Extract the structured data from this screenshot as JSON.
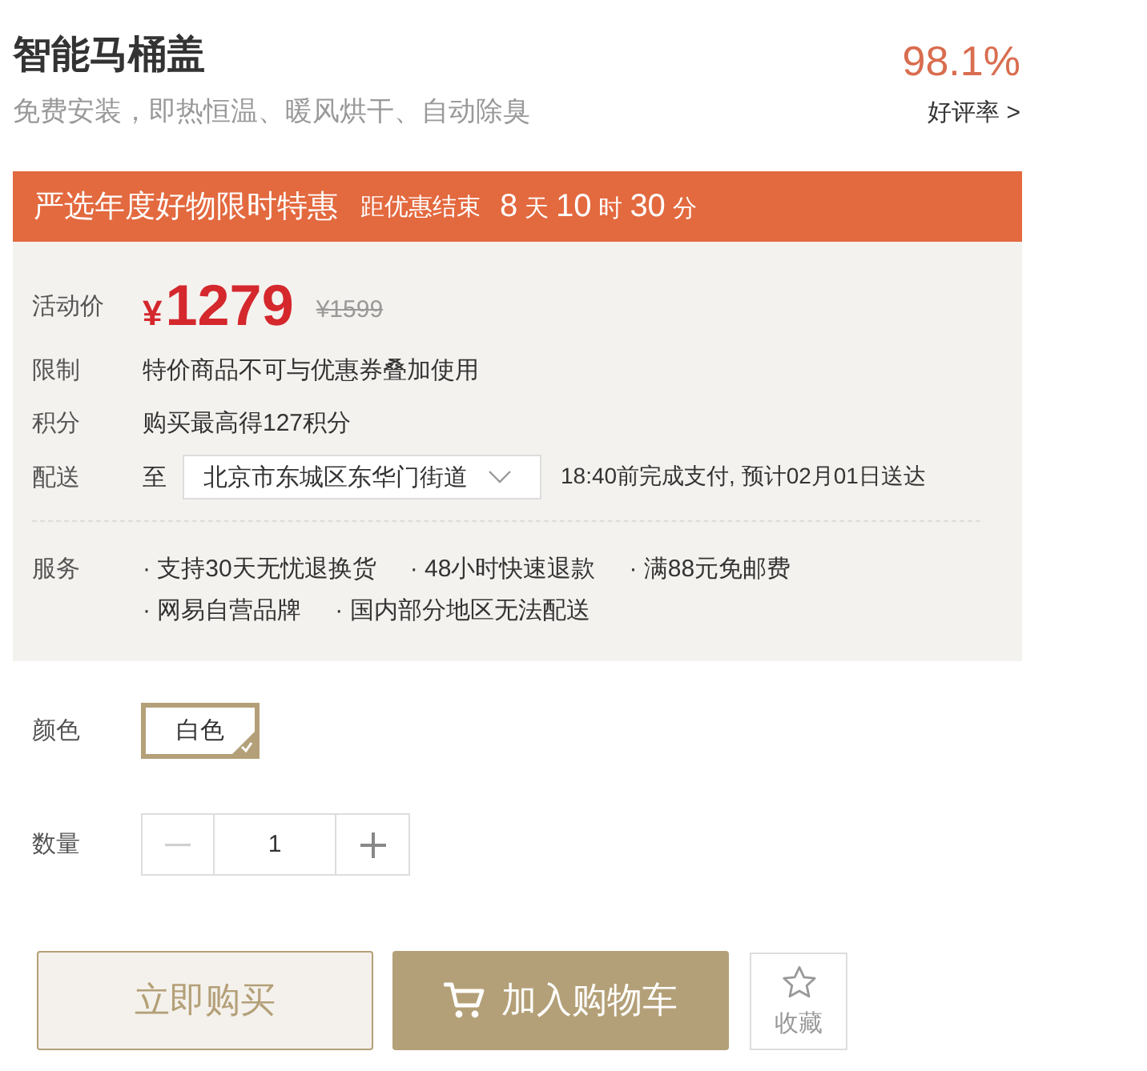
{
  "product": {
    "title": "智能马桶盖",
    "subtitle": "免费安装，即热恒温、暖风烘干、自动除臭"
  },
  "rating": {
    "value": "98.1%",
    "link": "好评率 >"
  },
  "promo": {
    "title": "严选年度好物限时特惠",
    "countdown_label": "距优惠结束",
    "countdown": [
      {
        "value": "8",
        "unit": "天"
      },
      {
        "value": "10",
        "unit": "时"
      },
      {
        "value": "30",
        "unit": "分"
      }
    ]
  },
  "details": {
    "price": {
      "label": "活动价",
      "currency": "¥",
      "amount": "1279",
      "original": "¥1599"
    },
    "rows": [
      {
        "kind": "text",
        "label": "限制",
        "text": "特价商品不可与优惠券叠加使用"
      },
      {
        "kind": "text",
        "label": "积分",
        "text": "购买最高得127积分"
      },
      {
        "kind": "delivery",
        "label": "配送",
        "prefix": "至",
        "address": "北京市东城区东华门街道",
        "note": "18:40前完成支付, 预计02月01日送达"
      }
    ],
    "services": {
      "label": "服务",
      "items": [
        "· 支持30天无忧退换货",
        "· 48小时快速退款",
        "· 满88元免邮费",
        "· 网易自营品牌",
        "· 国内部分地区无法配送"
      ]
    }
  },
  "color": {
    "label": "颜色",
    "options": [
      {
        "label": "白色",
        "selected": true
      }
    ]
  },
  "quantity": {
    "label": "数量",
    "value": "1",
    "decrease_disabled": true
  },
  "actions": [
    {
      "kind": "buy",
      "label": "立即购买"
    },
    {
      "kind": "cart",
      "label": "加入购物车"
    },
    {
      "kind": "favorite",
      "label": "收藏"
    }
  ]
}
